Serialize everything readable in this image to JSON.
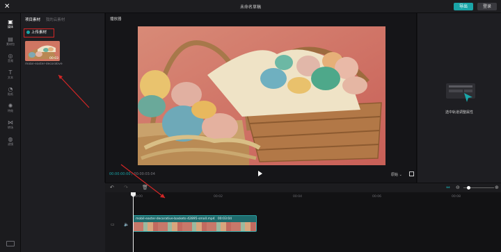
{
  "header": {
    "title": "未命名草稿",
    "export_label": "导出",
    "login_label": "登录"
  },
  "sidebar": {
    "items": [
      {
        "label": "媒体",
        "icon": "media-icon"
      },
      {
        "label": "素材包",
        "icon": "template-icon"
      },
      {
        "label": "音频",
        "icon": "audio-icon"
      },
      {
        "label": "文本",
        "icon": "text-icon"
      },
      {
        "label": "贴纸",
        "icon": "sticker-icon"
      },
      {
        "label": "特效",
        "icon": "effects-icon"
      },
      {
        "label": "转场",
        "icon": "transition-icon"
      },
      {
        "label": "滤镜",
        "icon": "filter-icon"
      }
    ]
  },
  "media": {
    "tab_project": "项目素材",
    "tab_cloud": "我的云素材",
    "upload_label": "上传素材",
    "thumb_duration": "00:03",
    "thumb_name": "mobil-easter-decorative"
  },
  "player": {
    "label": "播放器",
    "current_time": "00:00:00:00",
    "total_time": "00:00:03:04",
    "ratio_label": "原始"
  },
  "right_panel": {
    "hint": "选中轨道调整属性"
  },
  "timeline": {
    "ticks": [
      "00:00",
      "00:02",
      "00:04",
      "00:06",
      "00:08"
    ],
    "clip_name": "mobil-easter-decorative-baskets-42895-small.mp4",
    "clip_duration": "00:03:04"
  },
  "colors": {
    "accent": "#1aa5a8",
    "annotation": "#d32626"
  }
}
